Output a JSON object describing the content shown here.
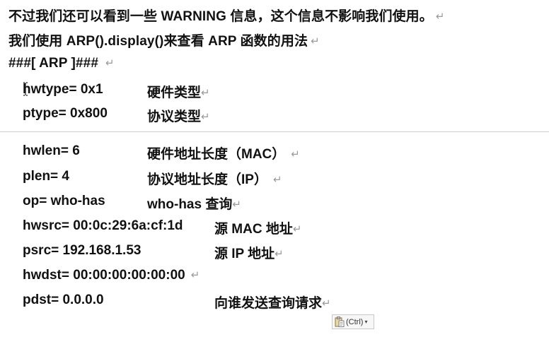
{
  "intro": {
    "line1": "不过我们还可以看到一些 WARNING 信息，这个信息不影响我们使用。",
    "line2": "我们使用 ARP().display()来查看 ARP 函数的用法",
    "line3": "###[ ARP ]###"
  },
  "paragraph_mark": "↵",
  "fields": [
    {
      "field": "hwtype= 0x1",
      "desc": "硬件类型"
    },
    {
      "field": "ptype= 0x800",
      "desc": "协议类型"
    },
    {
      "field": "hwlen= 6",
      "desc": "硬件地址长度（MAC）"
    },
    {
      "field": "plen= 4",
      "desc": "协议地址长度（IP）"
    },
    {
      "field": "op= who-has",
      "desc": "who-has 查询"
    },
    {
      "field": "hwsrc= 00:0c:29:6a:cf:1d",
      "desc": "源 MAC 地址"
    },
    {
      "field": "psrc= 192.168.1.53",
      "desc": "源 IP 地址"
    },
    {
      "field": "hwdst= 00:00:00:00:00:00",
      "desc": ""
    },
    {
      "field": "pdst= 0.0.0.0",
      "desc": "向谁发送查询请求"
    }
  ],
  "paste_options": {
    "label": "(Ctrl)",
    "icon": "clipboard-icon"
  }
}
